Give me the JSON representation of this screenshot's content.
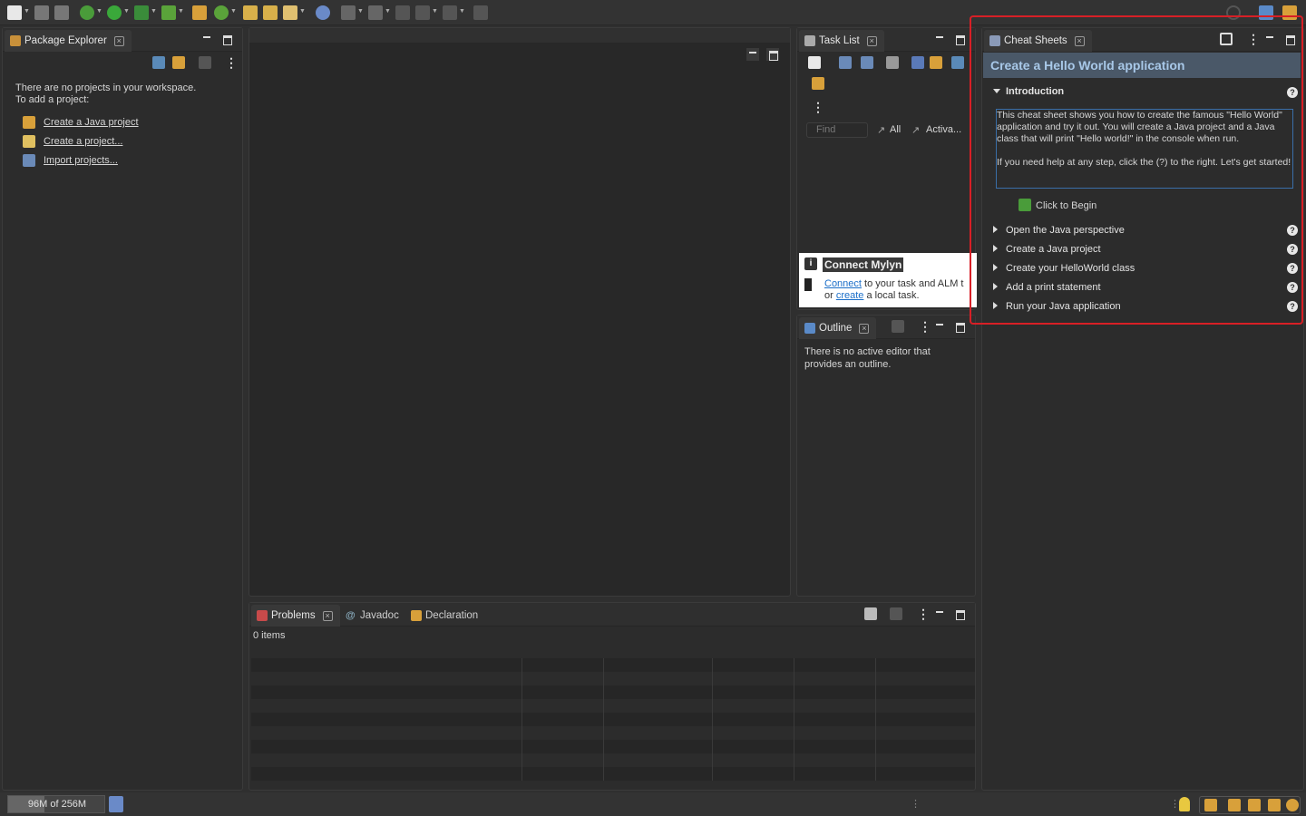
{
  "toolbar": {
    "icons": [
      "new-icon",
      "save-icon",
      "save-all-icon",
      "debug-icon",
      "run-icon",
      "coverage-icon",
      "external-tools-icon",
      "new-java-package-icon",
      "new-java-class-icon",
      "open-type-icon",
      "open-task-icon",
      "search-icon",
      "toggle-mark-occurrences-icon",
      "next-annotation-icon",
      "prev-annotation-icon",
      "last-edit-icon",
      "back-icon",
      "forward-icon",
      "pin-editor-icon"
    ],
    "right_icons": [
      "quick-access-search-icon",
      "java-ee-perspective-icon",
      "java-perspective-icon"
    ]
  },
  "package_explorer": {
    "tab_label": "Package Explorer",
    "empty_line1": "There are no projects in your workspace.",
    "empty_line2": "To add a project:",
    "links": [
      "Create a Java project",
      "Create a project...",
      "Import projects..."
    ]
  },
  "task_list": {
    "tab_label": "Task List",
    "find_placeholder": "Find",
    "filter_all": "All",
    "filter_active": "Activa...",
    "connect_title": "Connect Mylyn",
    "connect_link": "Connect",
    "connect_text1": " to your task and ALM t",
    "connect_or": "or ",
    "create_link": "create",
    "connect_text2": " a local task."
  },
  "outline": {
    "tab_label": "Outline",
    "empty_text": "There is no active editor that provides an outline."
  },
  "problems": {
    "tabs": [
      "Problems",
      "Javadoc",
      "Declaration"
    ],
    "items_count": "0 items"
  },
  "cheat_sheets": {
    "tab_label": "Cheat Sheets",
    "title": "Create a Hello World application",
    "intro_label": "Introduction",
    "intro_text1": "This cheat sheet shows you how to create the famous \"Hello World\" application and try it out. You will create a Java project and a Java class that will print \"Hello world!\" in the console when run.",
    "intro_text2": "If you need help at any step, click the (?) to the right. Let's get started!",
    "begin_label": "Click to Begin",
    "steps": [
      "Open the Java perspective",
      "Create a Java project",
      "Create your HelloWorld class",
      "Add a print statement",
      "Run your Java application"
    ]
  },
  "status": {
    "memory": "96M of 256M"
  },
  "colors": {
    "highlight_border": "#d81f26",
    "cheat_title_bg": "#4a5868",
    "cheat_title_text": "#a8c8e8",
    "link_blue": "#4da6ff"
  }
}
